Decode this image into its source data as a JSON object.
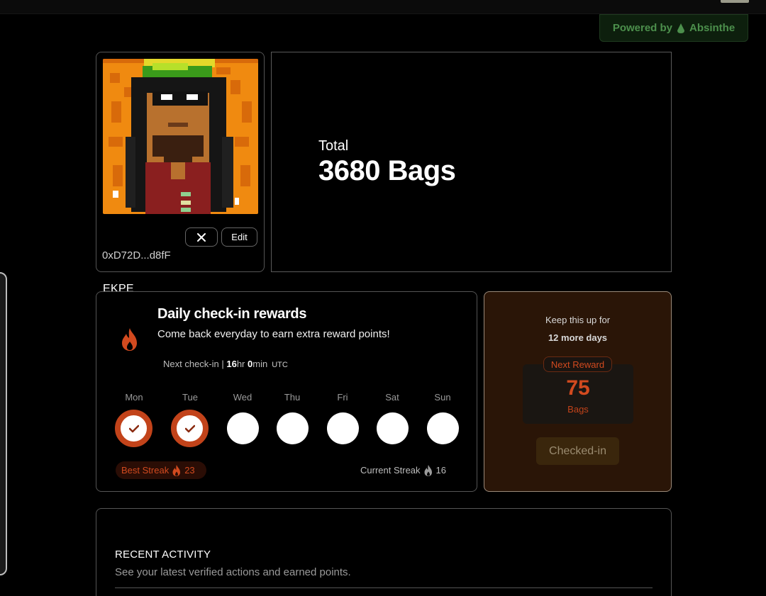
{
  "powered_by": {
    "prefix": "Powered by",
    "brand": "Absinthe",
    "icon": "droplet-icon"
  },
  "profile": {
    "name": "EKPE",
    "address": "0xD72D...d8fF",
    "close_icon": "close-icon",
    "edit_label": "Edit",
    "avatar_description_icon": "pixel-avatar"
  },
  "total": {
    "label": "Total",
    "value": "3680 Bags"
  },
  "checkin": {
    "title": "Daily check-in rewards",
    "subtitle": "Come back everyday to earn extra reward points!",
    "next_label": "Next check-in",
    "hours": "16",
    "hours_unit": "hr",
    "minutes": "0",
    "minutes_unit": "min",
    "timezone": "UTC",
    "days": [
      {
        "label": "Mon",
        "checked": true
      },
      {
        "label": "Tue",
        "checked": true
      },
      {
        "label": "Wed",
        "checked": false
      },
      {
        "label": "Thu",
        "checked": false
      },
      {
        "label": "Fri",
        "checked": false
      },
      {
        "label": "Sat",
        "checked": false
      },
      {
        "label": "Sun",
        "checked": false
      }
    ],
    "best_streak_label": "Best Streak",
    "best_streak_value": "23",
    "current_streak_label": "Current Streak",
    "current_streak_value": "16"
  },
  "reward": {
    "keep_label": "Keep this up for",
    "days_more": "12 more days",
    "next_label": "Next Reward",
    "next_value": "75",
    "next_unit": "Bags",
    "button_label": "Checked-in"
  },
  "activity": {
    "title": "RECENT ACTIVITY",
    "subtitle": "See your latest verified actions and earned points."
  },
  "colors": {
    "accent": "#c2431a",
    "accent_text": "#d24a1f",
    "reward_bg": "#2a1507",
    "brand_green": "#4c8f4c"
  }
}
